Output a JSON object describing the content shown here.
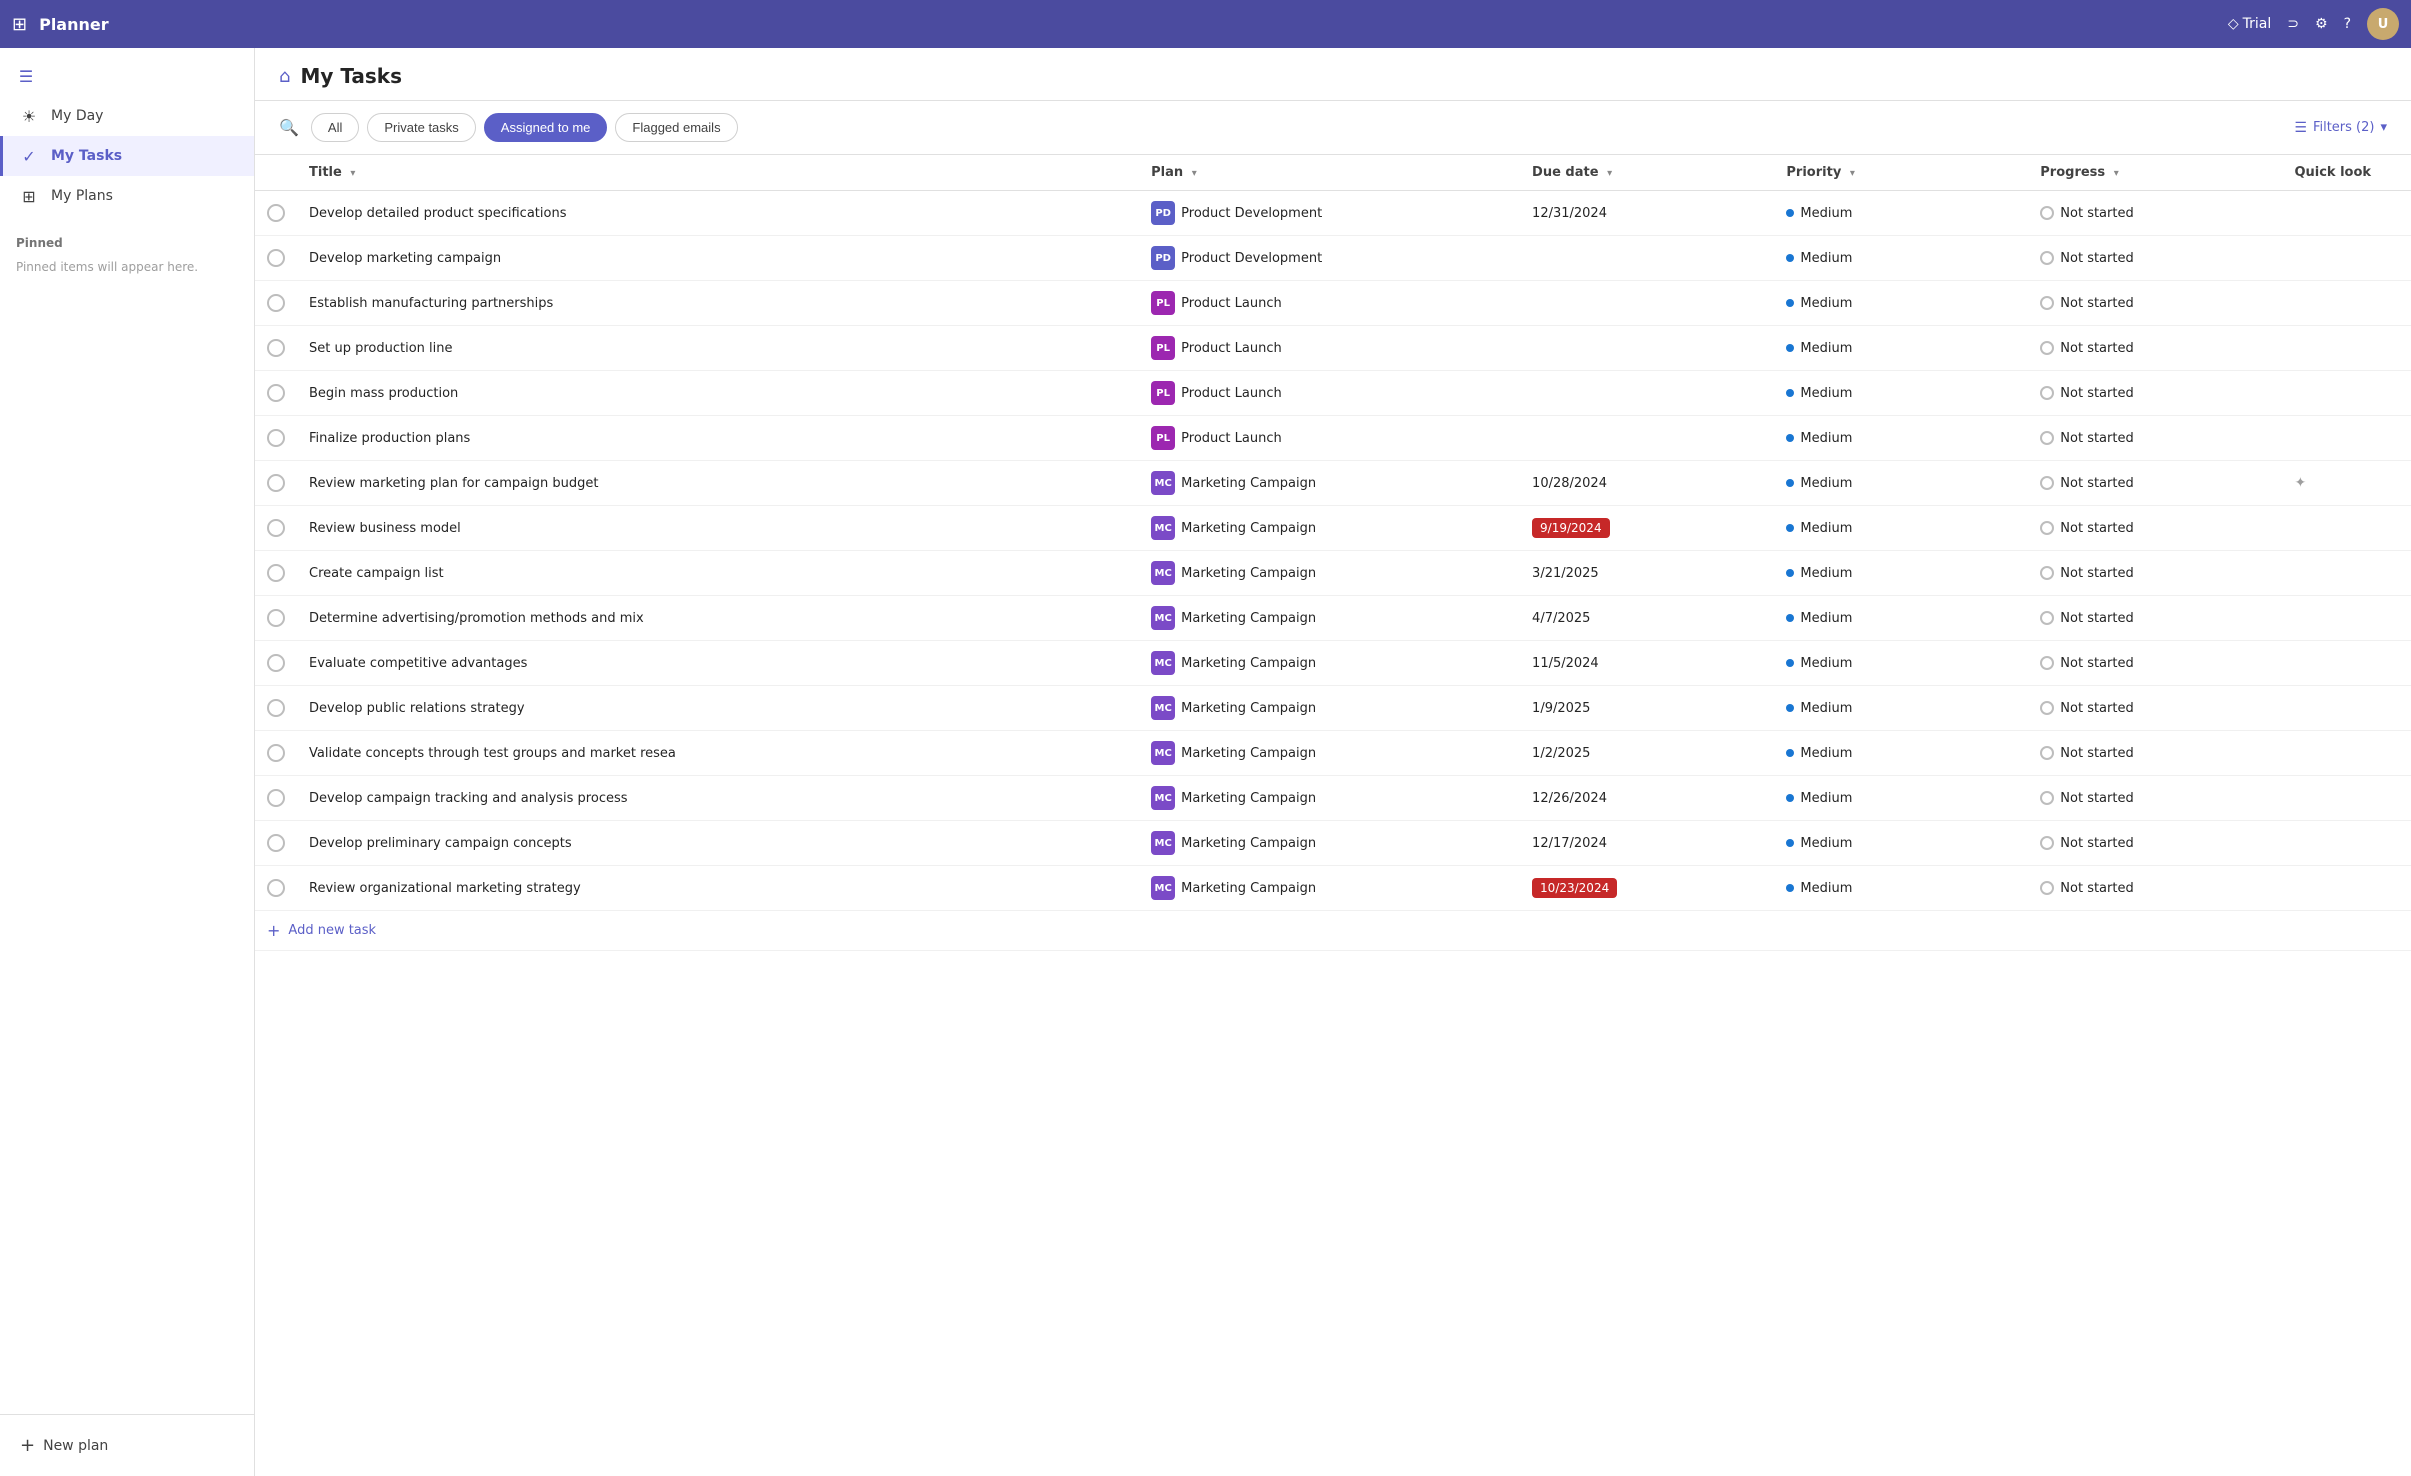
{
  "app": {
    "title": "Planner",
    "trial_label": "Trial"
  },
  "topbar": {
    "avatar_initials": "U"
  },
  "sidebar": {
    "collapse_icon": "☰",
    "nav_items": [
      {
        "id": "my-day",
        "label": "My Day",
        "icon": "☀"
      },
      {
        "id": "my-tasks",
        "label": "My Tasks",
        "icon": "✓",
        "active": true
      },
      {
        "id": "my-plans",
        "label": "My Plans",
        "icon": "⊞"
      }
    ],
    "pinned_label": "Pinned",
    "pinned_note": "Pinned items will appear here.",
    "new_plan_label": "New plan"
  },
  "page": {
    "title": "My Tasks",
    "icon": "🏠"
  },
  "filter_bar": {
    "tabs": [
      {
        "id": "all",
        "label": "All",
        "active": false
      },
      {
        "id": "private-tasks",
        "label": "Private tasks",
        "active": false
      },
      {
        "id": "assigned-to-me",
        "label": "Assigned to me",
        "active": true
      },
      {
        "id": "flagged-emails",
        "label": "Flagged emails",
        "active": false
      }
    ],
    "filters_label": "Filters (2)",
    "chevron": "▾"
  },
  "table": {
    "columns": [
      {
        "id": "title",
        "label": "Title",
        "sort": true
      },
      {
        "id": "plan",
        "label": "Plan",
        "sort": true
      },
      {
        "id": "due-date",
        "label": "Due date",
        "sort": true
      },
      {
        "id": "priority",
        "label": "Priority",
        "sort": true
      },
      {
        "id": "progress",
        "label": "Progress",
        "sort": true
      },
      {
        "id": "quick-look",
        "label": "Quick look",
        "sort": false
      }
    ],
    "rows": [
      {
        "id": 1,
        "title": "Develop detailed product specifications",
        "plan_abbr": "PD",
        "plan_name": "Product Development",
        "plan_class": "pd",
        "due_date": "12/31/2024",
        "due_overdue": false,
        "priority": "Medium",
        "progress": "Not started",
        "quick_look": false
      },
      {
        "id": 2,
        "title": "Develop marketing campaign",
        "plan_abbr": "PD",
        "plan_name": "Product Development",
        "plan_class": "pd",
        "due_date": "",
        "due_overdue": false,
        "priority": "Medium",
        "progress": "Not started",
        "quick_look": false
      },
      {
        "id": 3,
        "title": "Establish manufacturing partnerships",
        "plan_abbr": "PL",
        "plan_name": "Product Launch",
        "plan_class": "pl",
        "due_date": "",
        "due_overdue": false,
        "priority": "Medium",
        "progress": "Not started",
        "quick_look": false
      },
      {
        "id": 4,
        "title": "Set up production line",
        "plan_abbr": "PL",
        "plan_name": "Product Launch",
        "plan_class": "pl",
        "due_date": "",
        "due_overdue": false,
        "priority": "Medium",
        "progress": "Not started",
        "quick_look": false
      },
      {
        "id": 5,
        "title": "Begin mass production",
        "plan_abbr": "PL",
        "plan_name": "Product Launch",
        "plan_class": "pl",
        "due_date": "",
        "due_overdue": false,
        "priority": "Medium",
        "progress": "Not started",
        "quick_look": false
      },
      {
        "id": 6,
        "title": "Finalize production plans",
        "plan_abbr": "PL",
        "plan_name": "Product Launch",
        "plan_class": "pl",
        "due_date": "",
        "due_overdue": false,
        "priority": "Medium",
        "progress": "Not started",
        "quick_look": false
      },
      {
        "id": 7,
        "title": "Review marketing plan for campaign budget",
        "plan_abbr": "MC",
        "plan_name": "Marketing Campaign",
        "plan_class": "mc",
        "due_date": "10/28/2024",
        "due_overdue": false,
        "priority": "Medium",
        "progress": "Not started",
        "quick_look": true
      },
      {
        "id": 8,
        "title": "Review business model",
        "plan_abbr": "MC",
        "plan_name": "Marketing Campaign",
        "plan_class": "mc",
        "due_date": "9/19/2024",
        "due_overdue": true,
        "priority": "Medium",
        "progress": "Not started",
        "quick_look": false
      },
      {
        "id": 9,
        "title": "Create campaign list",
        "plan_abbr": "MC",
        "plan_name": "Marketing Campaign",
        "plan_class": "mc",
        "due_date": "3/21/2025",
        "due_overdue": false,
        "priority": "Medium",
        "progress": "Not started",
        "quick_look": false
      },
      {
        "id": 10,
        "title": "Determine advertising/promotion methods and mix",
        "plan_abbr": "MC",
        "plan_name": "Marketing Campaign",
        "plan_class": "mc",
        "due_date": "4/7/2025",
        "due_overdue": false,
        "priority": "Medium",
        "progress": "Not started",
        "quick_look": false
      },
      {
        "id": 11,
        "title": "Evaluate competitive advantages",
        "plan_abbr": "MC",
        "plan_name": "Marketing Campaign",
        "plan_class": "mc",
        "due_date": "11/5/2024",
        "due_overdue": false,
        "priority": "Medium",
        "progress": "Not started",
        "quick_look": false
      },
      {
        "id": 12,
        "title": "Develop public relations strategy",
        "plan_abbr": "MC",
        "plan_name": "Marketing Campaign",
        "plan_class": "mc",
        "due_date": "1/9/2025",
        "due_overdue": false,
        "priority": "Medium",
        "progress": "Not started",
        "quick_look": false
      },
      {
        "id": 13,
        "title": "Validate concepts through test groups and market resea",
        "plan_abbr": "MC",
        "plan_name": "Marketing Campaign",
        "plan_class": "mc",
        "due_date": "1/2/2025",
        "due_overdue": false,
        "priority": "Medium",
        "progress": "Not started",
        "quick_look": false
      },
      {
        "id": 14,
        "title": "Develop campaign tracking and analysis process",
        "plan_abbr": "MC",
        "plan_name": "Marketing Campaign",
        "plan_class": "mc",
        "due_date": "12/26/2024",
        "due_overdue": false,
        "priority": "Medium",
        "progress": "Not started",
        "quick_look": false
      },
      {
        "id": 15,
        "title": "Develop preliminary campaign concepts",
        "plan_abbr": "MC",
        "plan_name": "Marketing Campaign",
        "plan_class": "mc",
        "due_date": "12/17/2024",
        "due_overdue": false,
        "priority": "Medium",
        "progress": "Not started",
        "quick_look": false
      },
      {
        "id": 16,
        "title": "Review organizational marketing strategy",
        "plan_abbr": "MC",
        "plan_name": "Marketing Campaign",
        "plan_class": "mc",
        "due_date": "10/23/2024",
        "due_overdue": true,
        "priority": "Medium",
        "progress": "Not started",
        "quick_look": false
      }
    ],
    "add_task_label": "Add new task"
  }
}
